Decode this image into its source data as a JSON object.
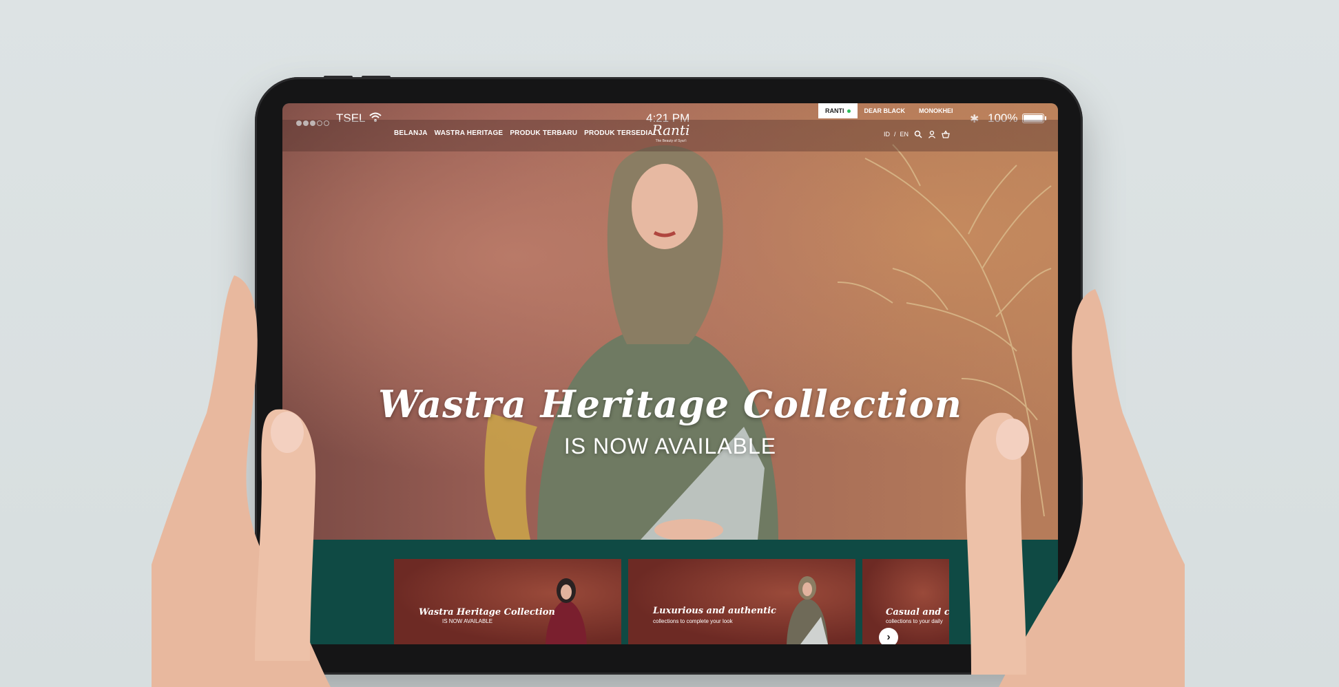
{
  "status_bar": {
    "carrier": "TSEL",
    "time": "4:21 PM",
    "battery": "100%",
    "battery_level": 1.0
  },
  "brand_tabs": [
    {
      "label": "RANTI",
      "active": true
    },
    {
      "label": "DEAR BLACK",
      "active": false
    },
    {
      "label": "MONOKHEI",
      "active": false
    }
  ],
  "nav": {
    "links": [
      "BELANJA",
      "WASTRA HERITAGE",
      "PRODUK TERBARU",
      "PRODUK TERSEDIA"
    ],
    "logo_text": "Ranti",
    "logo_tagline": "The Beauty of Syar'i",
    "lang_id": "ID",
    "lang_sep": "/",
    "lang_en": "EN",
    "icons": [
      "search-icon",
      "user-icon",
      "basket-icon"
    ]
  },
  "hero": {
    "title": "Wastra Heritage Collection",
    "subtitle": "IS NOW AVAILABLE"
  },
  "carousel": {
    "cards": [
      {
        "title": "Wastra Heritage Collection",
        "subtitle": "IS NOW AVAILABLE"
      },
      {
        "title": "Luxurious and authentic",
        "subtitle": "collections to complete your look"
      },
      {
        "title": "Casual and com",
        "subtitle": "collections to your daily"
      }
    ],
    "next_icon": "chevron-right-icon"
  },
  "colors": {
    "accent_green": "#0f4a44",
    "hero_bg": "#a86e58",
    "card_bg": "#6d2a24"
  }
}
